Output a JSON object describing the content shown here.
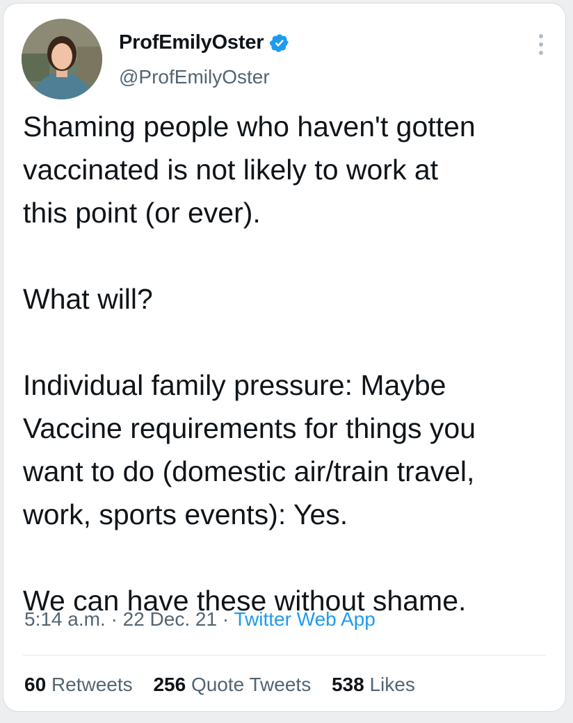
{
  "tweet": {
    "author": {
      "display_name": "ProfEmilyOster",
      "handle": "@ProfEmilyOster",
      "verified": true,
      "avatar_icon": "profile-photo"
    },
    "text_lines": [
      "Shaming people who haven't gotten",
      "vaccinated is not likely to work at",
      "this point (or ever).",
      "",
      "What will?",
      "",
      "Individual family pressure: Maybe",
      "Vaccine requirements for things you",
      "want to do (domestic air/train travel,",
      "work, sports events): Yes.",
      "",
      "We can have these without shame."
    ],
    "time": "5:14 a.m.",
    "date": "22 Dec. 21",
    "separator": "·",
    "source": "Twitter Web App",
    "stats": {
      "retweets": {
        "count": "60",
        "label": "Retweets"
      },
      "quote_tweets": {
        "count": "256",
        "label": "Quote Tweets"
      },
      "likes": {
        "count": "538",
        "label": "Likes"
      }
    }
  },
  "colors": {
    "link": "#1d9bf0",
    "muted": "#536471",
    "text": "#0f1419",
    "verified": "#1d9bf0"
  },
  "icons": {
    "more": "more-vertical-icon",
    "verified": "verified-badge-icon"
  }
}
